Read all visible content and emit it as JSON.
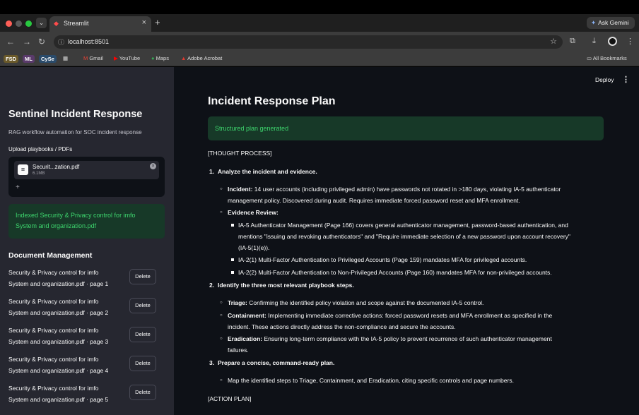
{
  "browser": {
    "tab_title": "Streamlit",
    "new_tab": "+",
    "ask_gemini": "Ask Gemini",
    "url": "localhost:8501",
    "bookmarks": [
      "FSD",
      "ML",
      "CySe",
      "Gmail",
      "YouTube",
      "Maps",
      "Adobe Acrobat"
    ],
    "all_bookmarks": "All Bookmarks"
  },
  "sidebar": {
    "title": "Sentinel Incident Response",
    "subtitle": "RAG workflow automation for SOC incident response",
    "upload_label": "Upload playbooks / PDFs",
    "file_name": "Securit...zation.pdf",
    "file_size": "6.1MB",
    "success_message": "Indexed Security & Privacy control for imfo System and organization.pdf",
    "doc_management_title": "Document Management",
    "delete_label": "Delete",
    "documents": [
      {
        "line1": "Security & Privacy control for imfo",
        "line2": "System and organization.pdf · page 1"
      },
      {
        "line1": "Security & Privacy control for imfo",
        "line2": "System and organization.pdf · page 2"
      },
      {
        "line1": "Security & Privacy control for imfo",
        "line2": "System and organization.pdf · page 3"
      },
      {
        "line1": "Security & Privacy control for imfo",
        "line2": "System and organization.pdf · page 4"
      },
      {
        "line1": "Security & Privacy control for imfo",
        "line2": "System and organization.pdf · page 5"
      }
    ]
  },
  "header": {
    "deploy": "Deploy"
  },
  "main": {
    "title": "Incident Response Plan",
    "success_message": "Structured plan generated",
    "thought_process": "[THOUGHT PROCESS]",
    "step1": "Analyze the incident and evidence.",
    "incident_label": "Incident:",
    "incident_l1": "14 user accounts (including privileged admin) have passwords not rotated in >180 days, violating IA-5 authenticator",
    "incident_l2": "management policy. Discovered during audit. Requires immediate forced password reset and MFA enrollment.",
    "evidence_label": "Evidence Review:",
    "ev1_l1": "IA-5 Authenticator Management (Page 166) covers general authenticator management, password-based authentication, and",
    "ev1_l2": "mentions \"issuing and revoking authenticators\" and \"Require immediate selection of a new password upon account recovery\"",
    "ev1_l3": "(IA-5(1)(e)).",
    "ev2": "IA-2(1) Multi-Factor Authentication to Privileged Accounts (Page 159) mandates MFA for privileged accounts.",
    "ev3": "IA-2(2) Multi-Factor Authentication to Non-Privileged Accounts (Page 160) mandates MFA for non-privileged accounts.",
    "step2": "Identify the three most relevant playbook steps.",
    "triage_label": "Triage:",
    "triage": "Confirming the identified policy violation and scope against the documented IA-5 control.",
    "containment_label": "Containment:",
    "containment_l1": "Implementing immediate corrective actions: forced password resets and MFA enrollment as specified in the",
    "containment_l2": "incident. These actions directly address the non-compliance and secure the accounts.",
    "eradication_label": "Eradication:",
    "eradication_l1": "Ensuring long-term compliance with the IA-5 policy to prevent recurrence of such authenticator management",
    "eradication_l2": "failures.",
    "step3": "Prepare a concise, command-ready plan.",
    "map_steps": "Map the identified steps to Triage, Containment, and Eradication, citing specific controls and page numbers.",
    "action_plan": "[ACTION PLAN]",
    "n1": "1.",
    "n2": "2.",
    "n3": "3."
  },
  "colors": {
    "sidebar_bg": "#262730",
    "main_bg": "#0e1117",
    "success_bg": "#173928",
    "success_text": "#3dd56d"
  }
}
